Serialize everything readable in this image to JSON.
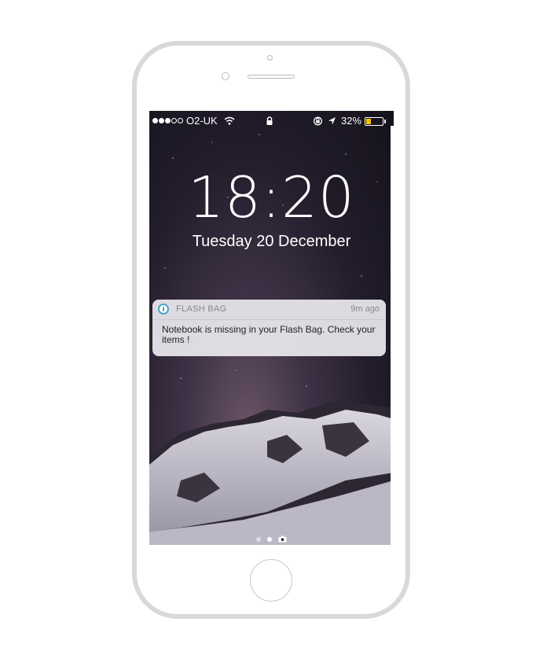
{
  "status_bar": {
    "signal_dots_on": 3,
    "signal_dots_off": 2,
    "carrier": "O2-UK",
    "battery_percent_label": "32%",
    "battery_level": 0.32,
    "battery_color": "#f5c400"
  },
  "lock_screen": {
    "time": "18:20",
    "date": "Tuesday 20 December"
  },
  "notification": {
    "app_name": "FLASH BAG",
    "time_ago": "9m ago",
    "message": "Notebook is missing in your Flash Bag. Check your items !",
    "icon": "flash-bag-app-icon",
    "accent_color": "#4aa3c8"
  },
  "pager": {
    "pages": 2,
    "active_index": 1,
    "trailing_icon": "camera-icon"
  }
}
